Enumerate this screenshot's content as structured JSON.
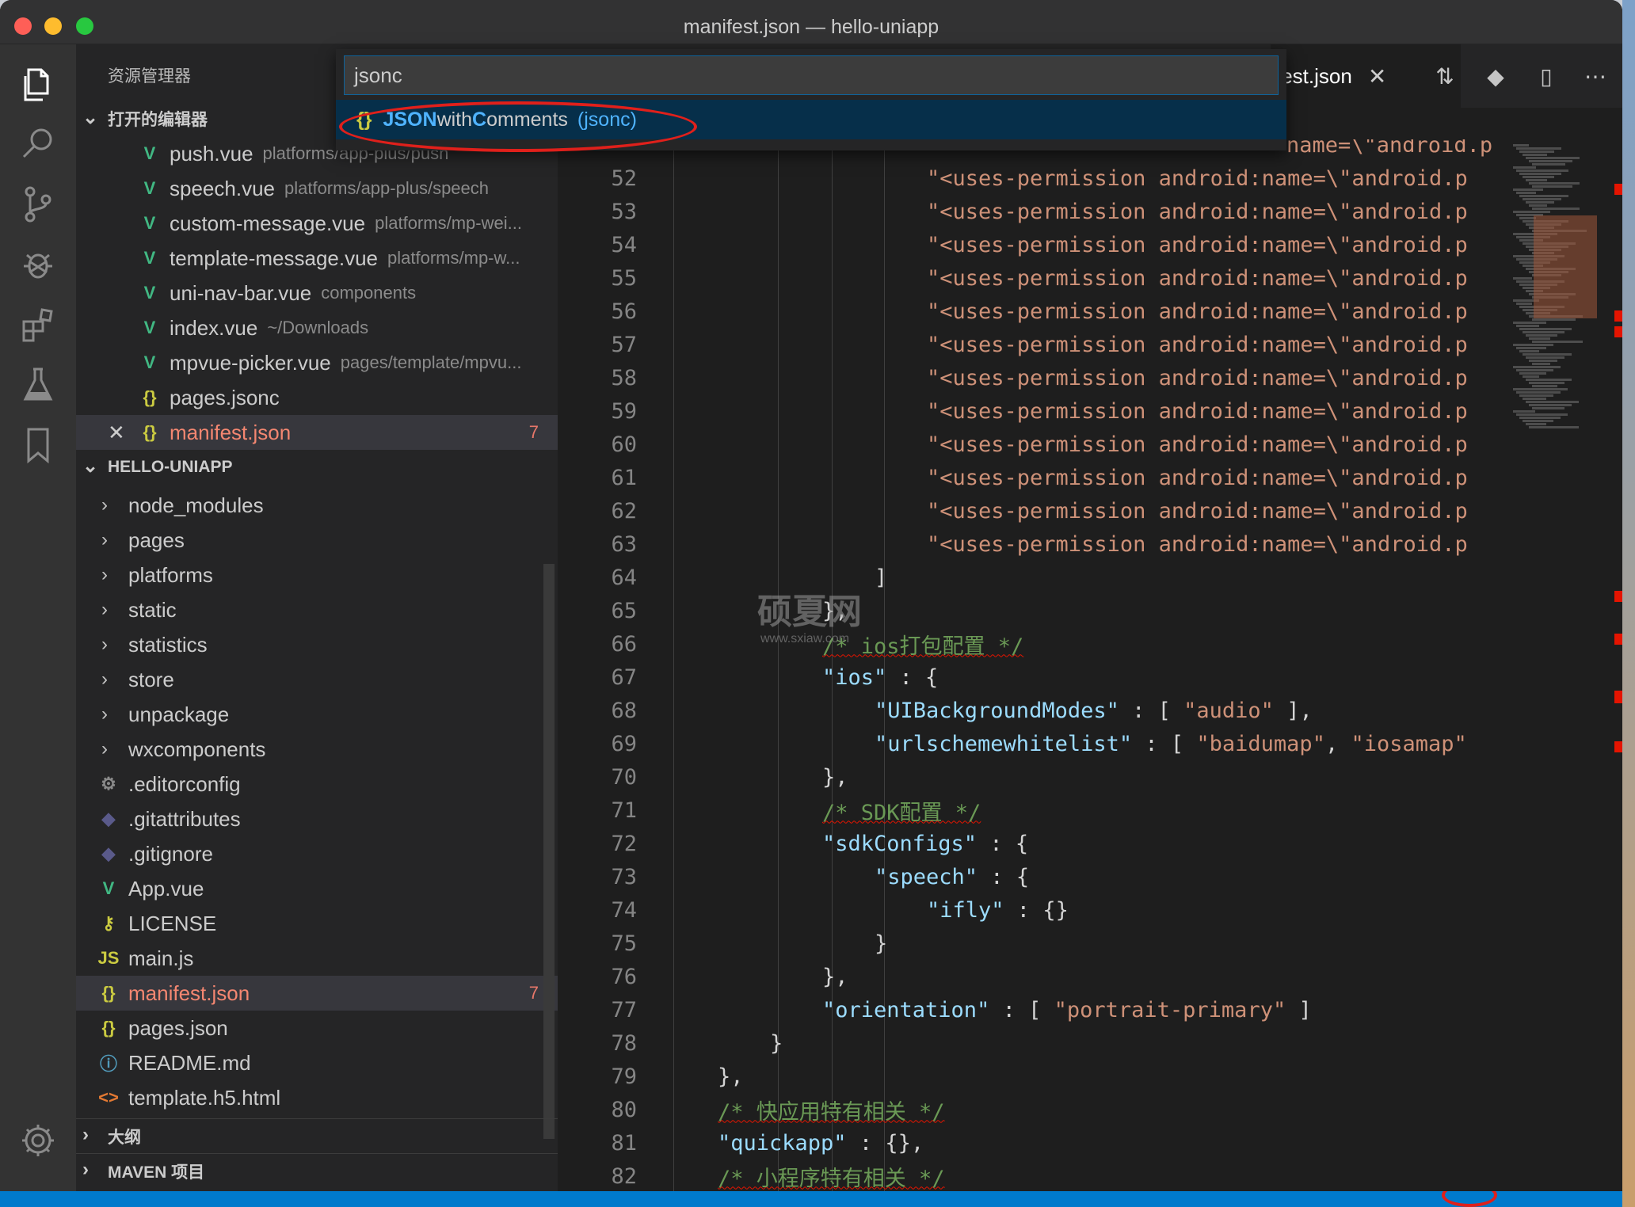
{
  "window": {
    "title": "manifest.json — hello-uniapp"
  },
  "sidebar": {
    "title": "资源管理器",
    "open_editors": {
      "label": "打开的编辑器",
      "items": [
        {
          "name": "push.vue",
          "desc": "platforms/app-plus/push",
          "icon": "vue-icon"
        },
        {
          "name": "speech.vue",
          "desc": "platforms/app-plus/speech",
          "icon": "vue-icon"
        },
        {
          "name": "custom-message.vue",
          "desc": "platforms/mp-wei...",
          "icon": "vue-icon"
        },
        {
          "name": "template-message.vue",
          "desc": "platforms/mp-w...",
          "icon": "vue-icon"
        },
        {
          "name": "uni-nav-bar.vue",
          "desc": "components",
          "icon": "vue-icon"
        },
        {
          "name": "index.vue",
          "desc": "~/Downloads",
          "icon": "vue-icon"
        },
        {
          "name": "mpvue-picker.vue",
          "desc": "pages/template/mpvu...",
          "icon": "vue-icon"
        },
        {
          "name": "pages.jsonc",
          "desc": "",
          "icon": "json-icon"
        },
        {
          "name": "manifest.json",
          "desc": "",
          "icon": "json-icon",
          "badge": "7"
        }
      ]
    },
    "project": {
      "label": "HELLO-UNIAPP",
      "items": [
        {
          "name": "node_modules"
        },
        {
          "name": "pages"
        },
        {
          "name": "platforms"
        },
        {
          "name": "static"
        },
        {
          "name": "statistics"
        },
        {
          "name": "store"
        },
        {
          "name": "unpackage"
        },
        {
          "name": "wxcomponents"
        },
        {
          "name": ".editorconfig"
        },
        {
          "name": ".gitattributes"
        },
        {
          "name": ".gitignore"
        },
        {
          "name": "App.vue"
        },
        {
          "name": "LICENSE"
        },
        {
          "name": "main.js"
        },
        {
          "name": "manifest.json",
          "badge": "7"
        },
        {
          "name": "pages.json"
        },
        {
          "name": "README.md"
        },
        {
          "name": "template.h5.html"
        }
      ]
    },
    "outline_label": "大纲",
    "maven_label": "MAVEN 项目"
  },
  "editor": {
    "active_tab": "fest.json",
    "lines": [
      {
        "n": "52",
        "text": "\"<uses-permission android:name=\\\"android.p"
      },
      {
        "n": "53",
        "text": "\"<uses-permission android:name=\\\"android.p"
      },
      {
        "n": "54",
        "text": "\"<uses-permission android:name=\\\"android.p"
      },
      {
        "n": "55",
        "text": "\"<uses-permission android:name=\\\"android.p"
      },
      {
        "n": "56",
        "text": "\"<uses-permission android:name=\\\"android.p"
      },
      {
        "n": "57",
        "text": "\"<uses-permission android:name=\\\"android.p"
      },
      {
        "n": "58",
        "text": "\"<uses-permission android:name=\\\"android.p"
      },
      {
        "n": "59",
        "text": "\"<uses-permission android:name=\\\"android.p"
      },
      {
        "n": "60",
        "text": "\"<uses-permission android:name=\\\"android.p"
      },
      {
        "n": "61",
        "text": "\"<uses-permission android:name=\\\"android.p"
      },
      {
        "n": "62",
        "text": "\"<uses-permission android:name=\\\"android.p"
      },
      {
        "n": "63",
        "text": "\"<uses-permission android:name=\\\"android.p"
      },
      {
        "n": "64",
        "text": "]"
      },
      {
        "n": "65",
        "text": "},"
      },
      {
        "n": "66",
        "text": "/* ios打包配置 */"
      },
      {
        "n": "67",
        "text": "\"ios\" : {"
      },
      {
        "n": "68",
        "text": "\"UIBackgroundModes\" : [ \"audio\" ],"
      },
      {
        "n": "69",
        "text": "\"urlschemewhitelist\" : [ \"baidumap\", \"iosamap\""
      },
      {
        "n": "70",
        "text": "},"
      },
      {
        "n": "71",
        "text": "/* SDK配置 */"
      },
      {
        "n": "72",
        "text": "\"sdkConfigs\" : {"
      },
      {
        "n": "73",
        "text": "\"speech\" : {"
      },
      {
        "n": "74",
        "text": "\"ifly\" : {}"
      },
      {
        "n": "75",
        "text": "}"
      },
      {
        "n": "76",
        "text": "},"
      },
      {
        "n": "77",
        "text": "\"orientation\" : [ \"portrait-primary\" ]"
      },
      {
        "n": "78",
        "text": "}"
      },
      {
        "n": "79",
        "text": "},"
      },
      {
        "n": "80",
        "text": "/* 快应用特有相关 */"
      },
      {
        "n": "81",
        "text": "\"quickapp\" : {},"
      },
      {
        "n": "82",
        "text": "/* 小程序特有相关 */"
      }
    ],
    "partial_top_line": "name=\\\"android.p"
  },
  "palette": {
    "input_value": "jsonc",
    "item": {
      "prefix": "JSON",
      "middle": " with ",
      "c": "C",
      "rest": "omments",
      "id": "(jsonc)"
    }
  },
  "watermark": {
    "text": "硕夏网",
    "url": "www.sxiaw.com"
  },
  "colors": {
    "accent": "#007acc",
    "annotation": "#e0201b",
    "error": "#f48771"
  }
}
